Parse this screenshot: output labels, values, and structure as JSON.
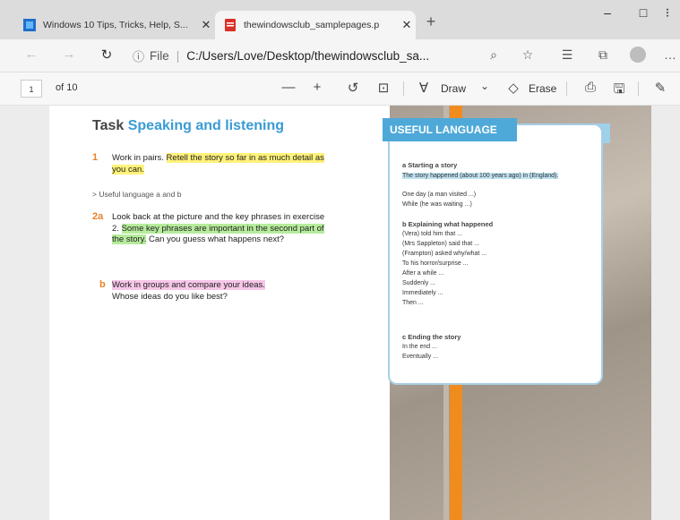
{
  "tabs": [
    {
      "title": "Windows 10 Tips, Tricks, Help, S...",
      "icon": "windows-club-favicon"
    },
    {
      "title": "thewindowsclub_samplepages.p",
      "icon": "pdf-favicon"
    }
  ],
  "window": {
    "minimize": "–",
    "maximize": "□",
    "close": "✕"
  },
  "address": {
    "scheme": "File",
    "path": "C:/Users/Love/Desktop/thewindowsclub_sa..."
  },
  "pdf_toolbar": {
    "page": "1",
    "of": "of 10",
    "draw": "Draw",
    "erase": "Erase"
  },
  "document": {
    "task_title": "Task",
    "task_subtitle": "Speaking and listening",
    "item1_num": "1",
    "item1_a": "Work in pairs. ",
    "item1_b": "Retell the story so far in as much detail as you can.",
    "ref": "> Useful language a and b",
    "item2_num": "2a",
    "item2_a": "Look back at the picture and the key phrases in exercise 2. ",
    "item2_b": "Some key phrases are important in the second part of the story.",
    "item2_c": " Can you guess what happens next?",
    "item3_num": "b",
    "item3_a": "Work in groups and compare your ideas.",
    "item3_b": "Whose ideas do you like best?"
  },
  "useful": {
    "title": "USEFUL LANGUAGE",
    "a_head": "a  Starting a story",
    "a_hl": "The story happened (about 100 years ago) in (England).",
    "a_lines": [
      "One day (a man visited ...)",
      "While (he was waiting ...)"
    ],
    "b_head": "b  Explaining what happened",
    "b_lines": [
      "(Vera) told him that ...",
      "(Mrs Sappleton) said that ...",
      "(Frampton) asked why/what ...",
      "To his horror/surprise ...",
      "After a while ...",
      "Suddenly ...",
      "Immediately ...",
      "Then ..."
    ],
    "c_head": "c  Ending the story",
    "c_lines": [
      "In the end ...",
      "Eventually ..."
    ]
  }
}
